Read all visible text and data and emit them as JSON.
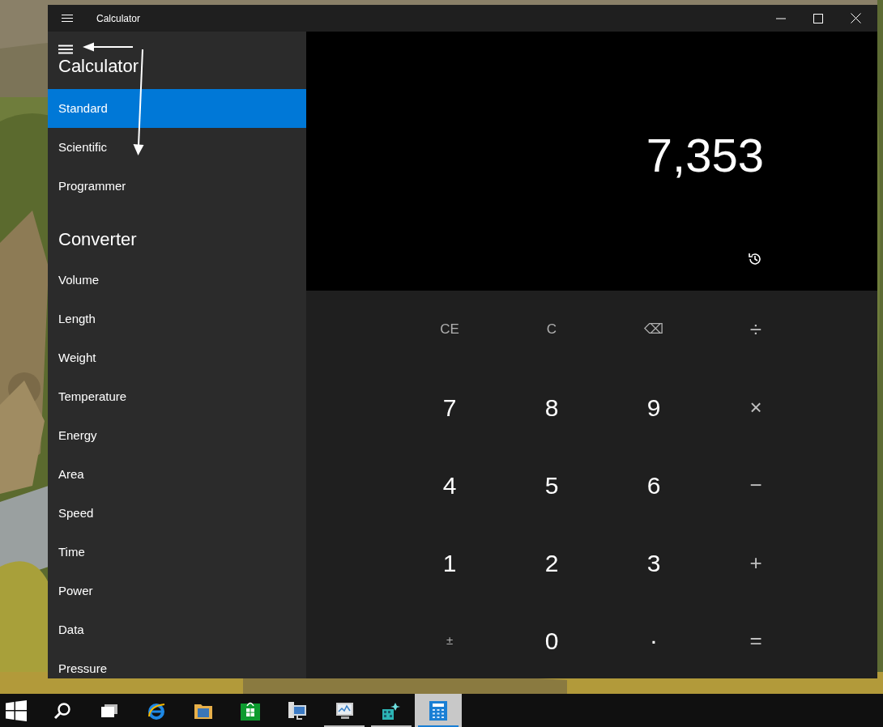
{
  "window": {
    "title": "Calculator"
  },
  "nav": {
    "sections": [
      {
        "header": "Calculator",
        "items": [
          {
            "label": "Standard",
            "selected": true
          },
          {
            "label": "Scientific",
            "selected": false
          },
          {
            "label": "Programmer",
            "selected": false
          }
        ]
      },
      {
        "header": "Converter",
        "items": [
          {
            "label": "Volume",
            "selected": false
          },
          {
            "label": "Length",
            "selected": false
          },
          {
            "label": "Weight",
            "selected": false
          },
          {
            "label": "Temperature",
            "selected": false
          },
          {
            "label": "Energy",
            "selected": false
          },
          {
            "label": "Area",
            "selected": false
          },
          {
            "label": "Speed",
            "selected": false
          },
          {
            "label": "Time",
            "selected": false
          },
          {
            "label": "Power",
            "selected": false
          },
          {
            "label": "Data",
            "selected": false
          },
          {
            "label": "Pressure",
            "selected": false
          }
        ]
      }
    ]
  },
  "display": {
    "value": "7,353"
  },
  "keys": [
    {
      "label": "CE",
      "kind": "function"
    },
    {
      "label": "C",
      "kind": "function"
    },
    {
      "label": "⌫",
      "kind": "function"
    },
    {
      "label": "÷",
      "kind": "operator"
    },
    {
      "label": "7",
      "kind": "digit"
    },
    {
      "label": "8",
      "kind": "digit"
    },
    {
      "label": "9",
      "kind": "digit"
    },
    {
      "label": "×",
      "kind": "operator"
    },
    {
      "label": "4",
      "kind": "digit"
    },
    {
      "label": "5",
      "kind": "digit"
    },
    {
      "label": "6",
      "kind": "digit"
    },
    {
      "label": "−",
      "kind": "operator"
    },
    {
      "label": "1",
      "kind": "digit"
    },
    {
      "label": "2",
      "kind": "digit"
    },
    {
      "label": "3",
      "kind": "digit"
    },
    {
      "label": "+",
      "kind": "operator"
    },
    {
      "label": "±",
      "kind": "sign"
    },
    {
      "label": "0",
      "kind": "digit"
    },
    {
      "label": ".",
      "kind": "point"
    },
    {
      "label": "=",
      "kind": "operator"
    }
  ],
  "taskbar": {
    "apps": [
      {
        "kind": "start",
        "running": false,
        "selected": false
      },
      {
        "kind": "search",
        "running": false,
        "selected": false
      },
      {
        "kind": "task-view",
        "running": false,
        "selected": false
      },
      {
        "kind": "browser",
        "running": false,
        "selected": false
      },
      {
        "kind": "folder",
        "running": false,
        "selected": false
      },
      {
        "kind": "store",
        "running": false,
        "selected": false
      },
      {
        "kind": "network",
        "running": false,
        "selected": false
      },
      {
        "kind": "monitor",
        "running": true,
        "selected": false
      },
      {
        "kind": "sparkle",
        "running": true,
        "selected": false
      },
      {
        "kind": "calculator",
        "running": true,
        "selected": true
      }
    ]
  }
}
